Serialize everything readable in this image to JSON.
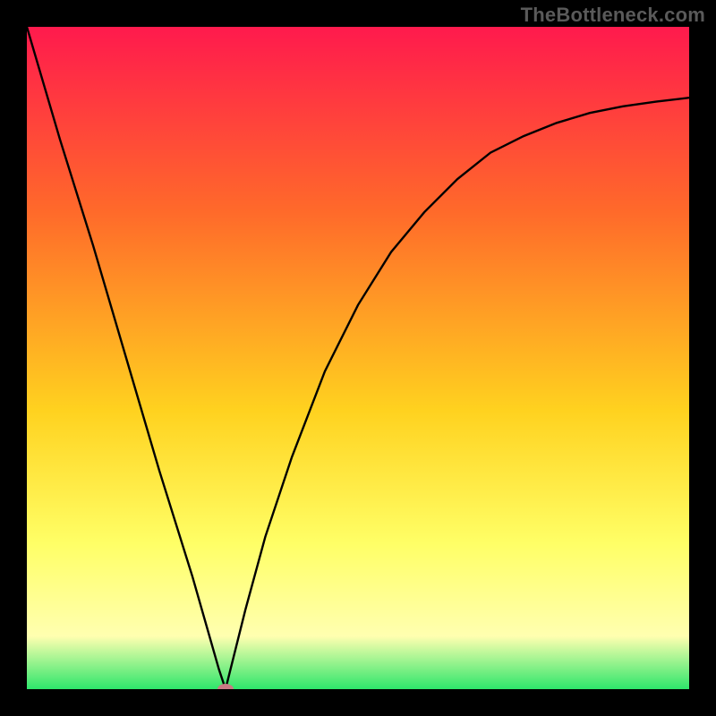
{
  "watermark": "TheBottleneck.com",
  "colors": {
    "frame": "#000000",
    "gradient_top": "#ff1a4d",
    "gradient_mid1": "#ff6a2a",
    "gradient_mid2": "#ffd21f",
    "gradient_mid3": "#ffff66",
    "gradient_mid4": "#ffffb0",
    "gradient_bot": "#2ee66b",
    "curve": "#000000",
    "dot": "#c97a84"
  },
  "chart_data": {
    "type": "line",
    "title": "",
    "xlabel": "",
    "ylabel": "",
    "xlim": [
      0,
      100
    ],
    "ylim": [
      0,
      100
    ],
    "axes_visible": false,
    "annotations": [
      {
        "label": "watermark",
        "text": "TheBottleneck.com"
      }
    ],
    "series": [
      {
        "name": "bottleneck-curve",
        "x": [
          0,
          5,
          10,
          15,
          20,
          25,
          27,
          29,
          30,
          31,
          33,
          36,
          40,
          45,
          50,
          55,
          60,
          65,
          70,
          75,
          80,
          85,
          90,
          95,
          100
        ],
        "y": [
          100,
          83,
          67,
          50,
          33,
          17,
          10,
          3,
          0,
          4,
          12,
          23,
          35,
          48,
          58,
          66,
          72,
          77,
          81,
          83.5,
          85.5,
          87,
          88,
          88.7,
          89.3
        ]
      }
    ],
    "marker": {
      "x": 30,
      "y": 0
    }
  }
}
